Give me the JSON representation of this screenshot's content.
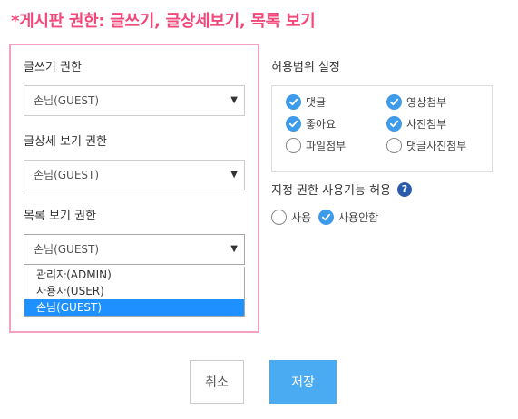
{
  "heading": "*게시판 권한: 글쓰기, 글상세보기, 목록 보기",
  "permissions": {
    "write": {
      "label": "글쓰기 권한",
      "value": "손님(GUEST)"
    },
    "detail": {
      "label": "글상세 보기 권한",
      "value": "손님(GUEST)"
    },
    "list": {
      "label": "목록 보기 권한",
      "value": "손님(GUEST)",
      "options": [
        "관리자(ADMIN)",
        "사용자(USER)",
        "손님(GUEST)"
      ],
      "selected_index": 2
    }
  },
  "scope": {
    "title": "허용범위 설정",
    "items": [
      {
        "label": "댓글",
        "checked": true
      },
      {
        "label": "영상첨부",
        "checked": true
      },
      {
        "label": "좋아요",
        "checked": true
      },
      {
        "label": "사진첨부",
        "checked": true
      },
      {
        "label": "파일첨부",
        "checked": false
      },
      {
        "label": "댓글사진첨부",
        "checked": false
      }
    ]
  },
  "custom_permission": {
    "label": "지정 권한 사용기능 허용",
    "help_icon": "?",
    "options": [
      {
        "label": "사용",
        "checked": false
      },
      {
        "label": "사용안함",
        "checked": true
      }
    ]
  },
  "buttons": {
    "cancel": "취소",
    "save": "저장"
  },
  "colors": {
    "heading": "#f2497a",
    "panel_border": "#f2a2c0",
    "checked": "#3d9be9",
    "save_button": "#4aabf3",
    "option_highlight": "#1e90ff",
    "help_icon": "#2b5cab"
  }
}
